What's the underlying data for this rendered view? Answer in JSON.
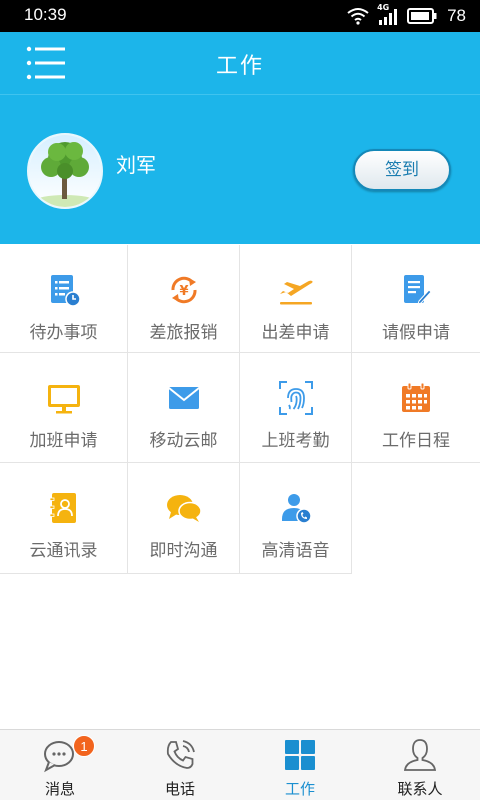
{
  "status_bar": {
    "time": "10:39",
    "network_label": "4G",
    "battery_level": "78",
    "icons": [
      "wifi-icon",
      "cell-signal-icon",
      "battery-icon"
    ]
  },
  "header": {
    "title": "工作",
    "menu_icon": "list-menu-icon"
  },
  "profile": {
    "name": "刘军",
    "avatar_icon": "tree-avatar",
    "checkin_label": "签到"
  },
  "colors": {
    "header_bg": "#1cb5ea",
    "tile_label": "#6b6b6b",
    "active_nav": "#1a8fd0",
    "badge": "#f2641e"
  },
  "grid": {
    "items": [
      {
        "label": "待办事项",
        "icon": "todo-list-icon",
        "color": "#3d9be9"
      },
      {
        "label": "差旅报销",
        "icon": "yuan-refresh-icon",
        "color": "#f07a26"
      },
      {
        "label": "出差申请",
        "icon": "airplane-icon",
        "color": "#f5a623"
      },
      {
        "label": "请假申请",
        "icon": "leave-form-icon",
        "color": "#3d9be9"
      },
      {
        "label": "加班申请",
        "icon": "monitor-icon",
        "color": "#f5b30f"
      },
      {
        "label": "移动云邮",
        "icon": "mail-icon",
        "color": "#3d9be9"
      },
      {
        "label": "上班考勤",
        "icon": "fingerprint-icon",
        "color": "#3d9be9"
      },
      {
        "label": "工作日程",
        "icon": "calendar-icon",
        "color": "#f07a26"
      },
      {
        "label": "云通讯录",
        "icon": "address-book-icon",
        "color": "#f5b30f"
      },
      {
        "label": "即时沟通",
        "icon": "chat-bubbles-icon",
        "color": "#f5b30f"
      },
      {
        "label": "高清语音",
        "icon": "voice-call-icon",
        "color": "#3d9be9"
      }
    ]
  },
  "bottom_nav": {
    "items": [
      {
        "label": "消息",
        "icon": "message-icon",
        "badge": "1",
        "active": false
      },
      {
        "label": "电话",
        "icon": "phone-icon",
        "active": false
      },
      {
        "label": "工作",
        "icon": "grid-icon",
        "active": true
      },
      {
        "label": "联系人",
        "icon": "contact-icon",
        "active": false
      }
    ]
  }
}
